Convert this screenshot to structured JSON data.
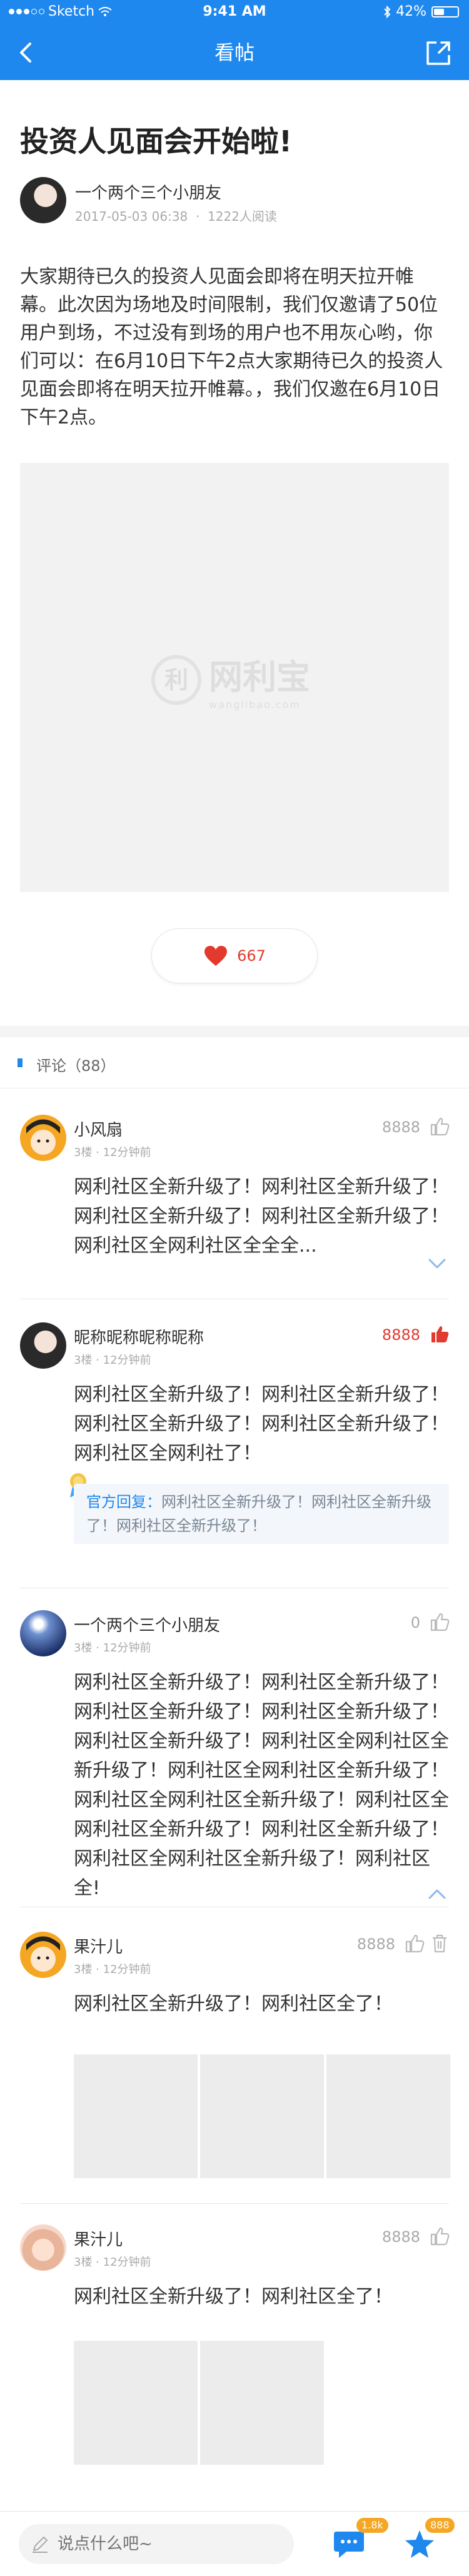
{
  "status_bar": {
    "carrier": "Sketch",
    "time": "9:41 AM",
    "battery": "42%"
  },
  "nav": {
    "title": "看帖"
  },
  "post": {
    "title": "投资人见面会开始啦!",
    "author": "一个两个三个小朋友",
    "date": "2017-05-03 06:38",
    "reads": "1222人阅读",
    "body": "大家期待已久的投资人见面会即将在明天拉开帷幕。此次因为场地及时间限制，我们仅邀请了50位用户到场，不过没有到场的用户也不用灰心哟，你们可以：在6月10日下午2点大家期待已久的投资人见面会即将在明天拉开帷幕。，我们仅邀在6月10日下午2点。",
    "watermark": {
      "glyph": "利",
      "name": "网利宝",
      "domain": "wanglibao.com"
    },
    "likes": "667"
  },
  "comments_header": "评论（88）",
  "comments": [
    {
      "name": "小风扇",
      "floor": "3楼",
      "time": "12分钟前",
      "likes": "8888",
      "text": "网利社区全新升级了！网利社区全新升级了！网利社区全新升级了！网利社区全新升级了！网利社区全网利社区全全全..."
    },
    {
      "name": "昵称昵称昵称昵称",
      "floor": "3楼",
      "time": "12分钟前",
      "likes": "8888",
      "text": "网利社区全新升级了！网利社区全新升级了！网利社区全新升级了！网利社区全新升级了！网利社区全网利社了！",
      "official_label": "官方回复：",
      "official_text": "网利社区全新升级了！网利社区全新升级了！网利社区全新升级了！"
    },
    {
      "name": "一个两个三个小朋友",
      "floor": "3楼",
      "time": "12分钟前",
      "likes": "0",
      "text": "网利社区全新升级了！网利社区全新升级了！网利社区全新升级了！网利社区全新升级了！网利社区全新升级了！网利社区全网利社区全新升级了！网利社区全网利社区全新升级了！网利社区全网利社区全新升级了！网利社区全网利社区全新升级了！网利社区全新升级了！网利社区全网利社区全新升级了！网利社区全!"
    },
    {
      "name": "果汁儿",
      "floor": "3楼",
      "time": "12分钟前",
      "likes": "8888",
      "text": "网利社区全新升级了！网利社区全了！"
    },
    {
      "name": "果汁儿",
      "floor": "3楼",
      "time": "12分钟前",
      "likes": "8888",
      "text": "网利社区全新升级了！网利社区全了！"
    }
  ],
  "bottom_bar": {
    "placeholder": "说点什么吧~",
    "comment_count": "1.8k",
    "favorite_count": "888"
  },
  "colors": {
    "brand": "#1f88ef",
    "like": "#e23a2e",
    "badge": "#f5a623"
  }
}
